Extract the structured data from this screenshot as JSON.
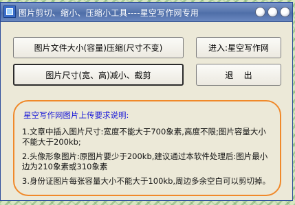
{
  "window": {
    "title": "图片剪切、缩小、压缩小工具----星空写作网专用"
  },
  "buttons": {
    "compress_label": "图片文件大小(容量)压缩(尺寸不变)",
    "enter_label": "进入:星空写作网",
    "resize_label": "图片尺寸(宽、高)减小、截剪",
    "exit_label": "退    出"
  },
  "notice": {
    "title": "星空写作网图片上传要求说明:",
    "items": [
      "1.文章中插入图片尺寸:宽度不能大于700象素,高度不限;图片容量大小不能大于200kb;",
      "2.头像形象图片:原图片要少于200kb,建议通过本软件处理后:图片最小边为210象素或310象素",
      "3.身份证图片每张容量大小不能大于100kb,周边多余空白可以剪切掉。"
    ]
  },
  "icons": {
    "app": "app-icon",
    "titlebar_buttons": [
      "minimize-icon",
      "maximize-icon",
      "close-icon"
    ]
  },
  "colors": {
    "notice_border": "#f0892a",
    "notice_title": "#1a1ad8",
    "titlebar": "#5a78b0",
    "window_bg": "#ece9d8"
  }
}
